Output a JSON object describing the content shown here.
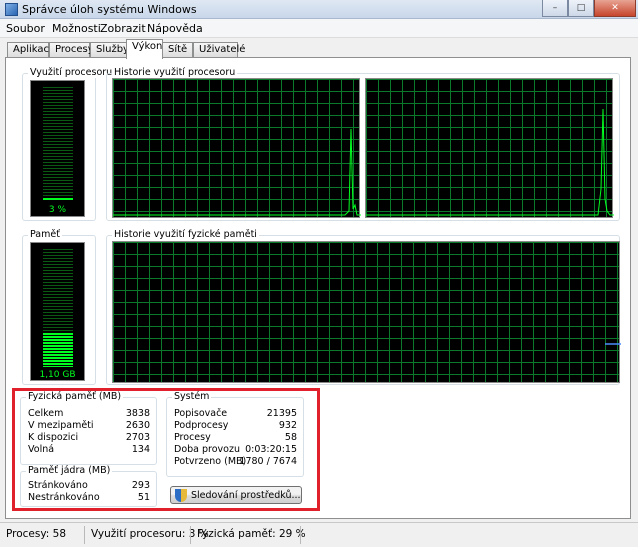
{
  "window": {
    "title": "Správce úloh systému Windows",
    "buttons": {
      "minimize": "–",
      "maximize": "□",
      "close": "✕"
    }
  },
  "menu": [
    "Soubor",
    "Možnosti",
    "Zobrazit",
    "Nápověda"
  ],
  "tabs": [
    {
      "label": "Aplikace",
      "active": false
    },
    {
      "label": "Procesy",
      "active": false
    },
    {
      "label": "Služby",
      "active": false
    },
    {
      "label": "Výkon",
      "active": true
    },
    {
      "label": "Sítě",
      "active": false
    },
    {
      "label": "Uživatelé",
      "active": false
    }
  ],
  "cpu": {
    "label": "Využití procesoru",
    "value": "3 %",
    "usage_percent": 3,
    "history_label": "Historie využití procesoru"
  },
  "memory": {
    "label": "Paměť",
    "value": "1,10 GB",
    "usage_percent": 29,
    "history_label": "Historie využití fyzické paměti"
  },
  "physical_memory": {
    "title": "Fyzická paměť (MB)",
    "rows": [
      {
        "key": "Celkem",
        "value": "3838"
      },
      {
        "key": "V mezipaměti",
        "value": "2630"
      },
      {
        "key": "K dispozici",
        "value": "2703"
      },
      {
        "key": "Volná",
        "value": "134"
      }
    ]
  },
  "kernel_memory": {
    "title": "Paměť jádra (MB)",
    "rows": [
      {
        "key": "Stránkováno",
        "value": "293"
      },
      {
        "key": "Nestránkováno",
        "value": "51"
      }
    ]
  },
  "system": {
    "title": "Systém",
    "rows": [
      {
        "key": "Popisovače",
        "value": "21395"
      },
      {
        "key": "Podprocesy",
        "value": "932"
      },
      {
        "key": "Procesy",
        "value": "58"
      },
      {
        "key": "Doba provozu",
        "value": "0:03:20:15"
      },
      {
        "key": "Potvrzeno (MB)",
        "value": "1780 / 7674"
      }
    ]
  },
  "resource_monitor_button": "Sledování prostředků...",
  "status": {
    "processes": "Procesy: 58",
    "cpu": "Využití procesoru: 3 %",
    "memory": "Fyzická paměť: 29 %"
  },
  "colors": {
    "graph_line": "#00ff20",
    "grid": "#0a7a2a",
    "highlight": "#e0202a"
  }
}
